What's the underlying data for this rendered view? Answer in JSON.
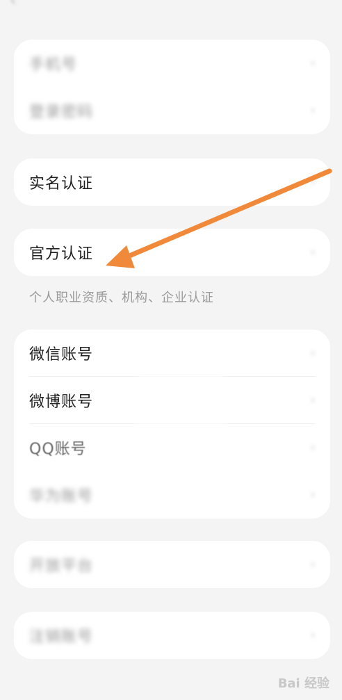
{
  "header": {
    "back_icon": "chevron-left-icon",
    "title": ""
  },
  "accounts_top": {
    "items": [
      {
        "label": "",
        "value": ""
      },
      {
        "label": "",
        "value": ""
      }
    ]
  },
  "real_name": {
    "label": "实名认证",
    "value": ""
  },
  "official": {
    "label": "官方认证",
    "value": "",
    "note": "个人职业资质、机构、企业认证"
  },
  "bindings": {
    "items": [
      {
        "label": "微信账号",
        "value": ""
      },
      {
        "label": "微博账号",
        "value": ""
      },
      {
        "label": "QQ账号",
        "value": ""
      },
      {
        "label": "",
        "value": ""
      }
    ]
  },
  "card5": {
    "label": "",
    "value": ""
  },
  "card6": {
    "label": ""
  },
  "annotation": {
    "arrow_color": "#f08a3a"
  },
  "watermark": {
    "text": "Bai 经验"
  }
}
